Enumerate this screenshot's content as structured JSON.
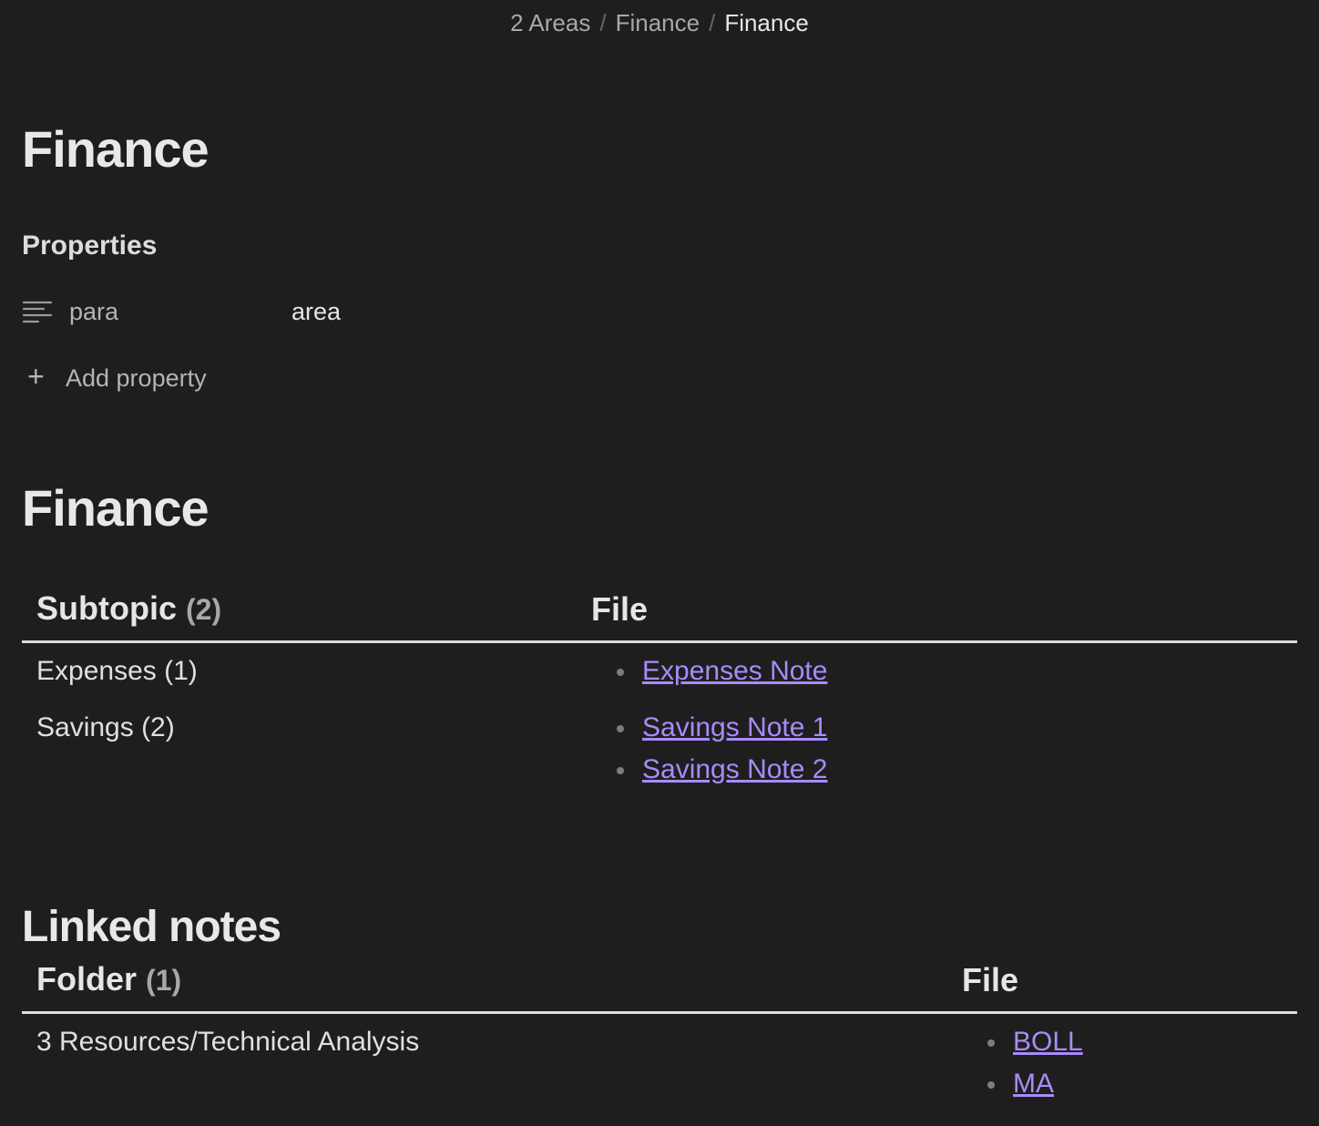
{
  "breadcrumb": {
    "items": [
      "2 Areas",
      "Finance"
    ],
    "current": "Finance",
    "separator": "/"
  },
  "title": "Finance",
  "properties": {
    "heading": "Properties",
    "rows": [
      {
        "icon": "list-lines-icon",
        "key": "para",
        "value": "area"
      }
    ],
    "add_label": "Add property"
  },
  "section_heading": "Finance",
  "subtopic_table": {
    "headers": {
      "col1": "Subtopic",
      "col1_count": "(2)",
      "col2": "File"
    },
    "rows": [
      {
        "label": "Expenses (1)",
        "files": [
          "Expenses Note"
        ]
      },
      {
        "label": "Savings (2)",
        "files": [
          "Savings Note 1",
          "Savings Note 2"
        ]
      }
    ]
  },
  "linked_notes": {
    "heading": "Linked notes",
    "headers": {
      "col1": "Folder",
      "col1_count": "(1)",
      "col2": "File"
    },
    "rows": [
      {
        "label": "3 Resources/Technical Analysis",
        "files": [
          "BOLL",
          "MA"
        ]
      }
    ]
  },
  "colors": {
    "background": "#1e1e1e",
    "link": "#a88bfa",
    "text": "#dadada"
  }
}
